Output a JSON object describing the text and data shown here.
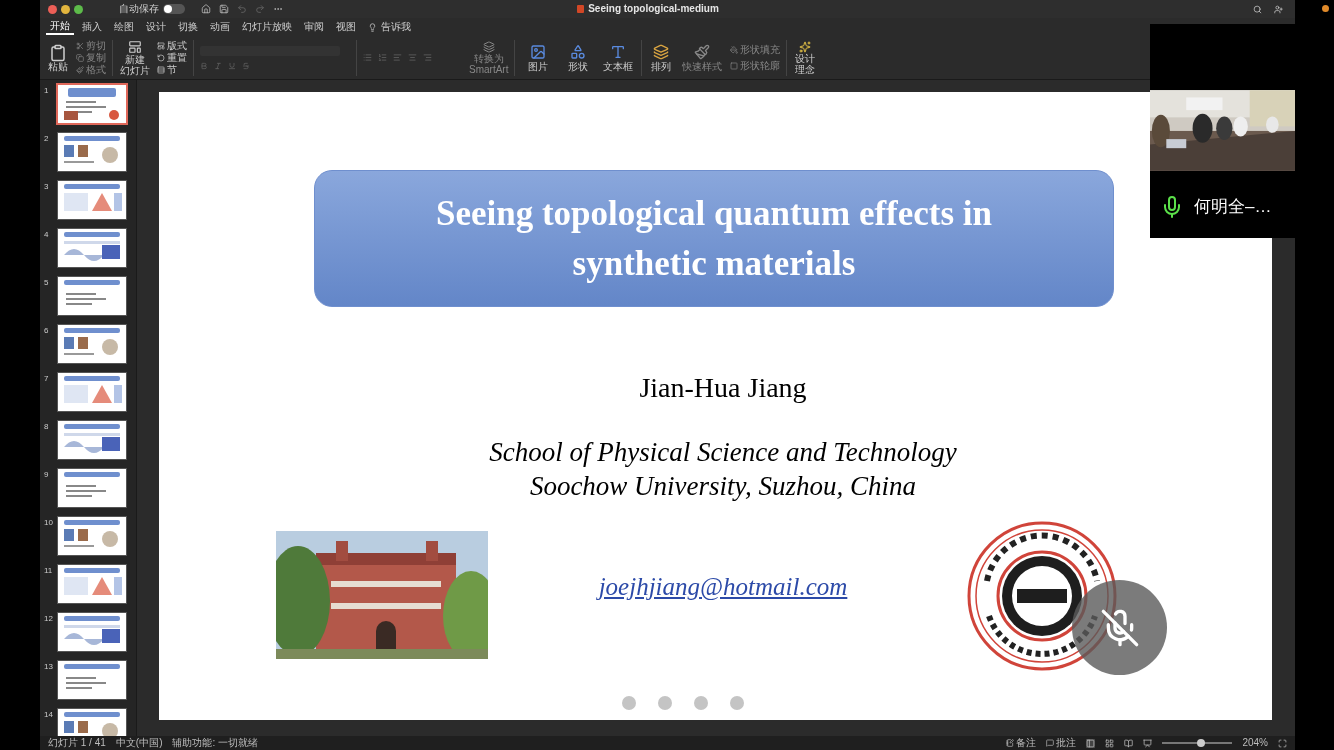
{
  "title_bar": {
    "autosave_label": "自动保存",
    "autosave_on": false,
    "document_title": "Seeing topological-medium"
  },
  "menu_tabs": [
    {
      "label": "开始",
      "selected": true
    },
    {
      "label": "插入",
      "selected": false
    },
    {
      "label": "绘图",
      "selected": false
    },
    {
      "label": "设计",
      "selected": false
    },
    {
      "label": "切换",
      "selected": false
    },
    {
      "label": "动画",
      "selected": false
    },
    {
      "label": "幻灯片放映",
      "selected": false
    },
    {
      "label": "审阅",
      "selected": false
    },
    {
      "label": "视图",
      "selected": false
    }
  ],
  "tell_me": "告诉我",
  "ribbon": {
    "paste": [
      "粘贴"
    ],
    "clipboard": [
      "剪切",
      "复制",
      "格式"
    ],
    "new_slide": [
      "新建",
      "幻灯片"
    ],
    "slide_tools": [
      "版式",
      "重置",
      "节"
    ],
    "smartart": [
      "转换为",
      "SmartArt"
    ],
    "insert": [
      [
        "图片"
      ],
      [
        "形状"
      ],
      [
        "文本框"
      ]
    ],
    "arrange": [
      "排列"
    ],
    "quick_styles": [
      "快速样式"
    ],
    "shape_tools": [
      "形状填充",
      "形状轮廓"
    ],
    "designer": [
      "设计",
      "理念"
    ]
  },
  "slides": [
    {
      "number": "1",
      "selected": true
    },
    {
      "number": "2",
      "selected": false
    },
    {
      "number": "3",
      "selected": false
    },
    {
      "number": "4",
      "selected": false
    },
    {
      "number": "5",
      "selected": false
    },
    {
      "number": "6",
      "selected": false
    },
    {
      "number": "7",
      "selected": false
    },
    {
      "number": "8",
      "selected": false
    },
    {
      "number": "9",
      "selected": false
    },
    {
      "number": "10",
      "selected": false
    },
    {
      "number": "11",
      "selected": false
    },
    {
      "number": "12",
      "selected": false
    },
    {
      "number": "13",
      "selected": false
    },
    {
      "number": "14",
      "selected": false
    }
  ],
  "slide": {
    "title": "Seeing topological quantum effects in synthetic materials",
    "author": "Jian-Hua Jiang",
    "affiliation": [
      "School of Physical Science and Technology",
      "Soochow University, Suzhou, China"
    ],
    "email": "joejhjiang@hotmail.com"
  },
  "mic_button": {
    "muted": true
  },
  "video": {
    "name": "何明全–…",
    "muted": false
  },
  "status_bar": {
    "slide_counter": "幻灯片 1 / 41",
    "language": "中文(中国)",
    "accessibility": "辅助功能: 一切就绪",
    "notes": "备注",
    "comments": "批注",
    "zoom": "204%",
    "zoom_slider": {
      "level": 0.55
    }
  }
}
